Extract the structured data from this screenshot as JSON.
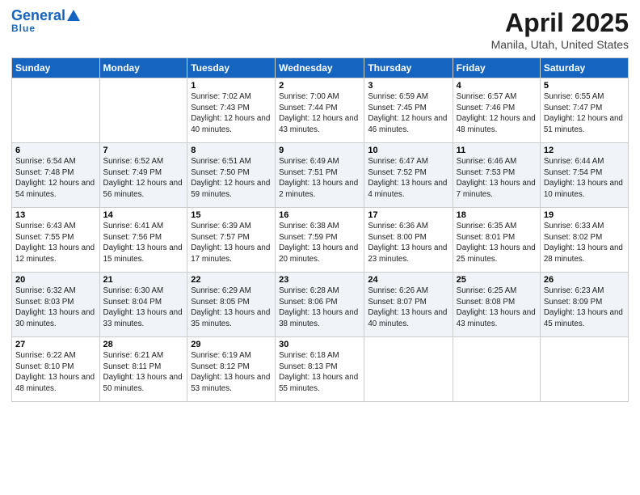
{
  "header": {
    "logo_line1": "General",
    "logo_line2": "Blue",
    "title": "April 2025",
    "subtitle": "Manila, Utah, United States"
  },
  "days_of_week": [
    "Sunday",
    "Monday",
    "Tuesday",
    "Wednesday",
    "Thursday",
    "Friday",
    "Saturday"
  ],
  "weeks": [
    [
      {
        "day": "",
        "info": ""
      },
      {
        "day": "",
        "info": ""
      },
      {
        "day": "1",
        "info": "Sunrise: 7:02 AM\nSunset: 7:43 PM\nDaylight: 12 hours and 40 minutes."
      },
      {
        "day": "2",
        "info": "Sunrise: 7:00 AM\nSunset: 7:44 PM\nDaylight: 12 hours and 43 minutes."
      },
      {
        "day": "3",
        "info": "Sunrise: 6:59 AM\nSunset: 7:45 PM\nDaylight: 12 hours and 46 minutes."
      },
      {
        "day": "4",
        "info": "Sunrise: 6:57 AM\nSunset: 7:46 PM\nDaylight: 12 hours and 48 minutes."
      },
      {
        "day": "5",
        "info": "Sunrise: 6:55 AM\nSunset: 7:47 PM\nDaylight: 12 hours and 51 minutes."
      }
    ],
    [
      {
        "day": "6",
        "info": "Sunrise: 6:54 AM\nSunset: 7:48 PM\nDaylight: 12 hours and 54 minutes."
      },
      {
        "day": "7",
        "info": "Sunrise: 6:52 AM\nSunset: 7:49 PM\nDaylight: 12 hours and 56 minutes."
      },
      {
        "day": "8",
        "info": "Sunrise: 6:51 AM\nSunset: 7:50 PM\nDaylight: 12 hours and 59 minutes."
      },
      {
        "day": "9",
        "info": "Sunrise: 6:49 AM\nSunset: 7:51 PM\nDaylight: 13 hours and 2 minutes."
      },
      {
        "day": "10",
        "info": "Sunrise: 6:47 AM\nSunset: 7:52 PM\nDaylight: 13 hours and 4 minutes."
      },
      {
        "day": "11",
        "info": "Sunrise: 6:46 AM\nSunset: 7:53 PM\nDaylight: 13 hours and 7 minutes."
      },
      {
        "day": "12",
        "info": "Sunrise: 6:44 AM\nSunset: 7:54 PM\nDaylight: 13 hours and 10 minutes."
      }
    ],
    [
      {
        "day": "13",
        "info": "Sunrise: 6:43 AM\nSunset: 7:55 PM\nDaylight: 13 hours and 12 minutes."
      },
      {
        "day": "14",
        "info": "Sunrise: 6:41 AM\nSunset: 7:56 PM\nDaylight: 13 hours and 15 minutes."
      },
      {
        "day": "15",
        "info": "Sunrise: 6:39 AM\nSunset: 7:57 PM\nDaylight: 13 hours and 17 minutes."
      },
      {
        "day": "16",
        "info": "Sunrise: 6:38 AM\nSunset: 7:59 PM\nDaylight: 13 hours and 20 minutes."
      },
      {
        "day": "17",
        "info": "Sunrise: 6:36 AM\nSunset: 8:00 PM\nDaylight: 13 hours and 23 minutes."
      },
      {
        "day": "18",
        "info": "Sunrise: 6:35 AM\nSunset: 8:01 PM\nDaylight: 13 hours and 25 minutes."
      },
      {
        "day": "19",
        "info": "Sunrise: 6:33 AM\nSunset: 8:02 PM\nDaylight: 13 hours and 28 minutes."
      }
    ],
    [
      {
        "day": "20",
        "info": "Sunrise: 6:32 AM\nSunset: 8:03 PM\nDaylight: 13 hours and 30 minutes."
      },
      {
        "day": "21",
        "info": "Sunrise: 6:30 AM\nSunset: 8:04 PM\nDaylight: 13 hours and 33 minutes."
      },
      {
        "day": "22",
        "info": "Sunrise: 6:29 AM\nSunset: 8:05 PM\nDaylight: 13 hours and 35 minutes."
      },
      {
        "day": "23",
        "info": "Sunrise: 6:28 AM\nSunset: 8:06 PM\nDaylight: 13 hours and 38 minutes."
      },
      {
        "day": "24",
        "info": "Sunrise: 6:26 AM\nSunset: 8:07 PM\nDaylight: 13 hours and 40 minutes."
      },
      {
        "day": "25",
        "info": "Sunrise: 6:25 AM\nSunset: 8:08 PM\nDaylight: 13 hours and 43 minutes."
      },
      {
        "day": "26",
        "info": "Sunrise: 6:23 AM\nSunset: 8:09 PM\nDaylight: 13 hours and 45 minutes."
      }
    ],
    [
      {
        "day": "27",
        "info": "Sunrise: 6:22 AM\nSunset: 8:10 PM\nDaylight: 13 hours and 48 minutes."
      },
      {
        "day": "28",
        "info": "Sunrise: 6:21 AM\nSunset: 8:11 PM\nDaylight: 13 hours and 50 minutes."
      },
      {
        "day": "29",
        "info": "Sunrise: 6:19 AM\nSunset: 8:12 PM\nDaylight: 13 hours and 53 minutes."
      },
      {
        "day": "30",
        "info": "Sunrise: 6:18 AM\nSunset: 8:13 PM\nDaylight: 13 hours and 55 minutes."
      },
      {
        "day": "",
        "info": ""
      },
      {
        "day": "",
        "info": ""
      },
      {
        "day": "",
        "info": ""
      }
    ]
  ]
}
